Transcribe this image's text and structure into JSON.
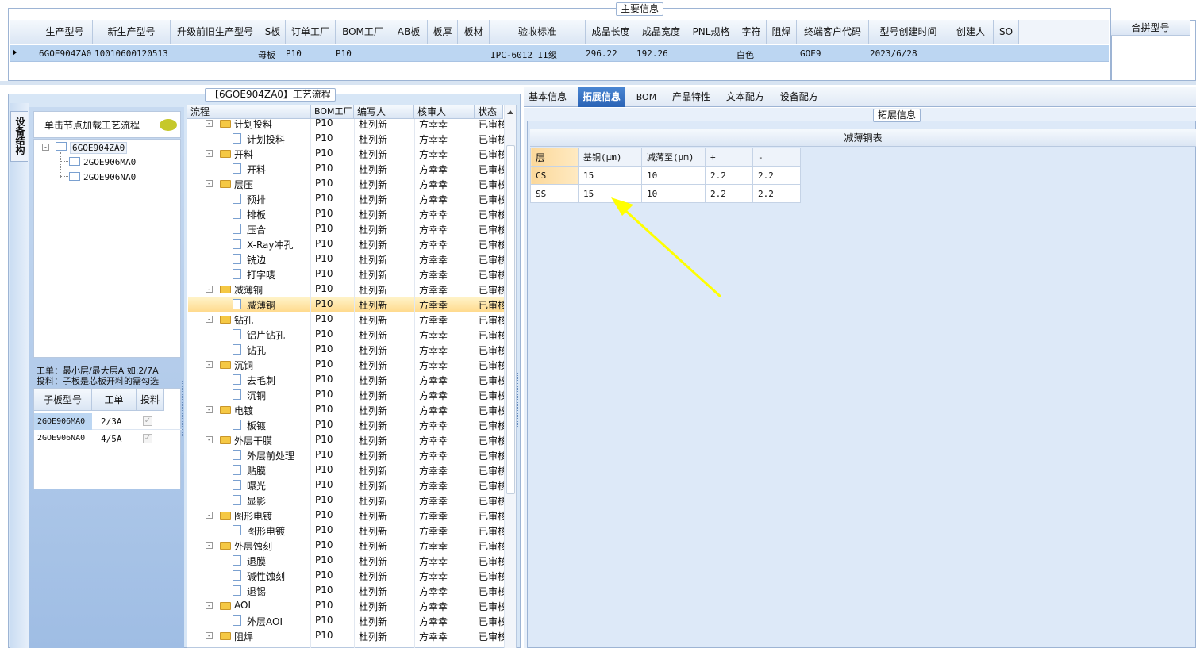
{
  "main_info": {
    "title": "主要信息",
    "columns": [
      "生产型号",
      "新生产型号",
      "升级前旧生产型号",
      "S板",
      "订单工厂",
      "BOM工厂",
      "AB板",
      "板厚",
      "板材",
      "验收标准",
      "成品长度",
      "成品宽度",
      "PNL规格",
      "字符",
      "阻焊",
      "终端客户代码",
      "型号创建时间",
      "创建人",
      "SO"
    ],
    "row": {
      "prod_model": "6GOE904ZA0",
      "new_model": "10010600120513",
      "s_board": "母板",
      "order_factory": "P10",
      "bom_factory": "P10",
      "standard": "IPC-6012 II级",
      "length": "296.22",
      "width": "192.26",
      "char": "白色",
      "customer": "GOE9",
      "created": "2023/6/28"
    },
    "merge_label": "合拼型号"
  },
  "process_title": "【6GOE904ZA0】工艺流程",
  "left_panel": {
    "side_tab": "设备结构",
    "hint": "单击节点加载工艺流程",
    "tree": [
      "6GOE904ZA0",
      "2GOE906MA0",
      "2GOE906NA0"
    ],
    "note1": "工单：最小层/最大层A 如:2/7A",
    "note2": "投料：子板是芯板开料的需勾选",
    "sub_headers": [
      "子板型号",
      "工单",
      "投料"
    ],
    "sub_rows": [
      {
        "model": "2GOE906MA0",
        "order": "2/3A"
      },
      {
        "model": "2GOE906NA0",
        "order": "4/5A"
      }
    ]
  },
  "flow": {
    "headers": [
      "流程",
      "BOM工厂",
      "编写人",
      "核审人",
      "状态"
    ],
    "rows": [
      {
        "name": "计划投料",
        "lvl": 0,
        "factory": "P10",
        "writer": "杜列新",
        "reviewer": "方幸幸",
        "status": "已审核"
      },
      {
        "name": "计划投料",
        "lvl": 1,
        "factory": "P10",
        "writer": "杜列新",
        "reviewer": "方幸幸",
        "status": "已审核"
      },
      {
        "name": "开料",
        "lvl": 0,
        "factory": "P10",
        "writer": "杜列新",
        "reviewer": "方幸幸",
        "status": "已审核"
      },
      {
        "name": "开料",
        "lvl": 1,
        "factory": "P10",
        "writer": "杜列新",
        "reviewer": "方幸幸",
        "status": "已审核"
      },
      {
        "name": "层压",
        "lvl": 0,
        "factory": "P10",
        "writer": "杜列新",
        "reviewer": "方幸幸",
        "status": "已审核"
      },
      {
        "name": "预排",
        "lvl": 1,
        "factory": "P10",
        "writer": "杜列新",
        "reviewer": "方幸幸",
        "status": "已审核"
      },
      {
        "name": "排板",
        "lvl": 1,
        "factory": "P10",
        "writer": "杜列新",
        "reviewer": "方幸幸",
        "status": "已审核"
      },
      {
        "name": "压合",
        "lvl": 1,
        "factory": "P10",
        "writer": "杜列新",
        "reviewer": "方幸幸",
        "status": "已审核"
      },
      {
        "name": "X-Ray冲孔",
        "lvl": 1,
        "factory": "P10",
        "writer": "杜列新",
        "reviewer": "方幸幸",
        "status": "已审核"
      },
      {
        "name": "铣边",
        "lvl": 1,
        "factory": "P10",
        "writer": "杜列新",
        "reviewer": "方幸幸",
        "status": "已审核"
      },
      {
        "name": "打字唛",
        "lvl": 1,
        "factory": "P10",
        "writer": "杜列新",
        "reviewer": "方幸幸",
        "status": "已审核"
      },
      {
        "name": "减薄铜",
        "lvl": 0,
        "factory": "P10",
        "writer": "杜列新",
        "reviewer": "方幸幸",
        "status": "已审核"
      },
      {
        "name": "减薄铜",
        "lvl": 1,
        "factory": "P10",
        "writer": "杜列新",
        "reviewer": "方幸幸",
        "status": "已审核",
        "selected": true
      },
      {
        "name": "钻孔",
        "lvl": 0,
        "factory": "P10",
        "writer": "杜列新",
        "reviewer": "方幸幸",
        "status": "已审核"
      },
      {
        "name": "铝片钻孔",
        "lvl": 1,
        "factory": "P10",
        "writer": "杜列新",
        "reviewer": "方幸幸",
        "status": "已审核"
      },
      {
        "name": "钻孔",
        "lvl": 1,
        "factory": "P10",
        "writer": "杜列新",
        "reviewer": "方幸幸",
        "status": "已审核"
      },
      {
        "name": "沉铜",
        "lvl": 0,
        "factory": "P10",
        "writer": "杜列新",
        "reviewer": "方幸幸",
        "status": "已审核"
      },
      {
        "name": "去毛刺",
        "lvl": 1,
        "factory": "P10",
        "writer": "杜列新",
        "reviewer": "方幸幸",
        "status": "已审核"
      },
      {
        "name": "沉铜",
        "lvl": 1,
        "factory": "P10",
        "writer": "杜列新",
        "reviewer": "方幸幸",
        "status": "已审核"
      },
      {
        "name": "电镀",
        "lvl": 0,
        "factory": "P10",
        "writer": "杜列新",
        "reviewer": "方幸幸",
        "status": "已审核"
      },
      {
        "name": "板镀",
        "lvl": 1,
        "factory": "P10",
        "writer": "杜列新",
        "reviewer": "方幸幸",
        "status": "已审核"
      },
      {
        "name": "外层干膜",
        "lvl": 0,
        "factory": "P10",
        "writer": "杜列新",
        "reviewer": "方幸幸",
        "status": "已审核"
      },
      {
        "name": "外层前处理",
        "lvl": 1,
        "factory": "P10",
        "writer": "杜列新",
        "reviewer": "方幸幸",
        "status": "已审核"
      },
      {
        "name": "贴膜",
        "lvl": 1,
        "factory": "P10",
        "writer": "杜列新",
        "reviewer": "方幸幸",
        "status": "已审核"
      },
      {
        "name": "曝光",
        "lvl": 1,
        "factory": "P10",
        "writer": "杜列新",
        "reviewer": "方幸幸",
        "status": "已审核"
      },
      {
        "name": "显影",
        "lvl": 1,
        "factory": "P10",
        "writer": "杜列新",
        "reviewer": "方幸幸",
        "status": "已审核"
      },
      {
        "name": "图形电镀",
        "lvl": 0,
        "factory": "P10",
        "writer": "杜列新",
        "reviewer": "方幸幸",
        "status": "已审核"
      },
      {
        "name": "图形电镀",
        "lvl": 1,
        "factory": "P10",
        "writer": "杜列新",
        "reviewer": "方幸幸",
        "status": "已审核"
      },
      {
        "name": "外层蚀刻",
        "lvl": 0,
        "factory": "P10",
        "writer": "杜列新",
        "reviewer": "方幸幸",
        "status": "已审核"
      },
      {
        "name": "退膜",
        "lvl": 1,
        "factory": "P10",
        "writer": "杜列新",
        "reviewer": "方幸幸",
        "status": "已审核"
      },
      {
        "name": "碱性蚀刻",
        "lvl": 1,
        "factory": "P10",
        "writer": "杜列新",
        "reviewer": "方幸幸",
        "status": "已审核"
      },
      {
        "name": "退锡",
        "lvl": 1,
        "factory": "P10",
        "writer": "杜列新",
        "reviewer": "方幸幸",
        "status": "已审核"
      },
      {
        "name": "AOI",
        "lvl": 0,
        "factory": "P10",
        "writer": "杜列新",
        "reviewer": "方幸幸",
        "status": "已审核"
      },
      {
        "name": "外层AOI",
        "lvl": 1,
        "factory": "P10",
        "writer": "杜列新",
        "reviewer": "方幸幸",
        "status": "已审核"
      },
      {
        "name": "阻焊",
        "lvl": 0,
        "factory": "P10",
        "writer": "杜列新",
        "reviewer": "方幸幸",
        "status": "已审核"
      }
    ]
  },
  "tabs": [
    "基本信息",
    "拓展信息",
    "BOM",
    "产品特性",
    "文本配方",
    "设备配方"
  ],
  "ext": {
    "legend": "拓展信息",
    "table_title": "减薄铜表",
    "headers": [
      "层",
      "基铜(μm)",
      "减薄至(μm)",
      "+",
      "-"
    ],
    "rows": [
      [
        "CS",
        "15",
        "10",
        "2.2",
        "2.2"
      ],
      [
        "SS",
        "15",
        "10",
        "2.2",
        "2.2"
      ]
    ]
  },
  "colors": {
    "accent": "#2a63b5",
    "selected_row": "#bcd6f2",
    "arrow": "#ffff00"
  }
}
